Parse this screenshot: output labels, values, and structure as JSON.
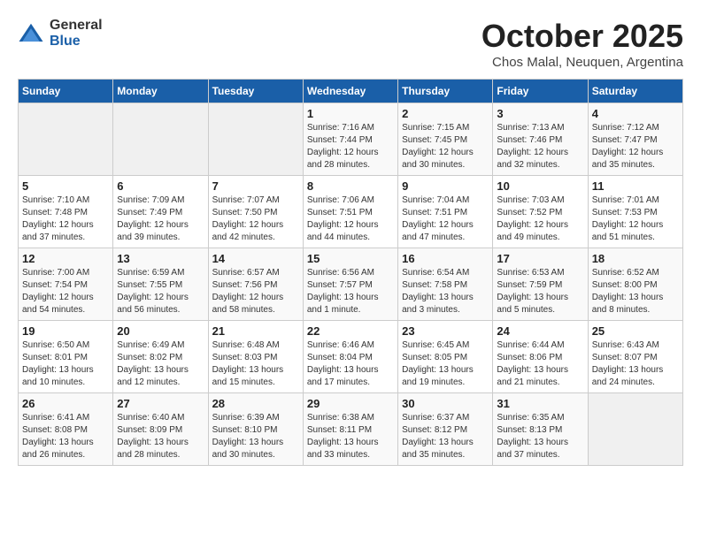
{
  "header": {
    "logo_general": "General",
    "logo_blue": "Blue",
    "month_year": "October 2025",
    "location": "Chos Malal, Neuquen, Argentina"
  },
  "weekdays": [
    "Sunday",
    "Monday",
    "Tuesday",
    "Wednesday",
    "Thursday",
    "Friday",
    "Saturday"
  ],
  "weeks": [
    [
      {
        "day": "",
        "info": ""
      },
      {
        "day": "",
        "info": ""
      },
      {
        "day": "",
        "info": ""
      },
      {
        "day": "1",
        "info": "Sunrise: 7:16 AM\nSunset: 7:44 PM\nDaylight: 12 hours\nand 28 minutes."
      },
      {
        "day": "2",
        "info": "Sunrise: 7:15 AM\nSunset: 7:45 PM\nDaylight: 12 hours\nand 30 minutes."
      },
      {
        "day": "3",
        "info": "Sunrise: 7:13 AM\nSunset: 7:46 PM\nDaylight: 12 hours\nand 32 minutes."
      },
      {
        "day": "4",
        "info": "Sunrise: 7:12 AM\nSunset: 7:47 PM\nDaylight: 12 hours\nand 35 minutes."
      }
    ],
    [
      {
        "day": "5",
        "info": "Sunrise: 7:10 AM\nSunset: 7:48 PM\nDaylight: 12 hours\nand 37 minutes."
      },
      {
        "day": "6",
        "info": "Sunrise: 7:09 AM\nSunset: 7:49 PM\nDaylight: 12 hours\nand 39 minutes."
      },
      {
        "day": "7",
        "info": "Sunrise: 7:07 AM\nSunset: 7:50 PM\nDaylight: 12 hours\nand 42 minutes."
      },
      {
        "day": "8",
        "info": "Sunrise: 7:06 AM\nSunset: 7:51 PM\nDaylight: 12 hours\nand 44 minutes."
      },
      {
        "day": "9",
        "info": "Sunrise: 7:04 AM\nSunset: 7:51 PM\nDaylight: 12 hours\nand 47 minutes."
      },
      {
        "day": "10",
        "info": "Sunrise: 7:03 AM\nSunset: 7:52 PM\nDaylight: 12 hours\nand 49 minutes."
      },
      {
        "day": "11",
        "info": "Sunrise: 7:01 AM\nSunset: 7:53 PM\nDaylight: 12 hours\nand 51 minutes."
      }
    ],
    [
      {
        "day": "12",
        "info": "Sunrise: 7:00 AM\nSunset: 7:54 PM\nDaylight: 12 hours\nand 54 minutes."
      },
      {
        "day": "13",
        "info": "Sunrise: 6:59 AM\nSunset: 7:55 PM\nDaylight: 12 hours\nand 56 minutes."
      },
      {
        "day": "14",
        "info": "Sunrise: 6:57 AM\nSunset: 7:56 PM\nDaylight: 12 hours\nand 58 minutes."
      },
      {
        "day": "15",
        "info": "Sunrise: 6:56 AM\nSunset: 7:57 PM\nDaylight: 13 hours\nand 1 minute."
      },
      {
        "day": "16",
        "info": "Sunrise: 6:54 AM\nSunset: 7:58 PM\nDaylight: 13 hours\nand 3 minutes."
      },
      {
        "day": "17",
        "info": "Sunrise: 6:53 AM\nSunset: 7:59 PM\nDaylight: 13 hours\nand 5 minutes."
      },
      {
        "day": "18",
        "info": "Sunrise: 6:52 AM\nSunset: 8:00 PM\nDaylight: 13 hours\nand 8 minutes."
      }
    ],
    [
      {
        "day": "19",
        "info": "Sunrise: 6:50 AM\nSunset: 8:01 PM\nDaylight: 13 hours\nand 10 minutes."
      },
      {
        "day": "20",
        "info": "Sunrise: 6:49 AM\nSunset: 8:02 PM\nDaylight: 13 hours\nand 12 minutes."
      },
      {
        "day": "21",
        "info": "Sunrise: 6:48 AM\nSunset: 8:03 PM\nDaylight: 13 hours\nand 15 minutes."
      },
      {
        "day": "22",
        "info": "Sunrise: 6:46 AM\nSunset: 8:04 PM\nDaylight: 13 hours\nand 17 minutes."
      },
      {
        "day": "23",
        "info": "Sunrise: 6:45 AM\nSunset: 8:05 PM\nDaylight: 13 hours\nand 19 minutes."
      },
      {
        "day": "24",
        "info": "Sunrise: 6:44 AM\nSunset: 8:06 PM\nDaylight: 13 hours\nand 21 minutes."
      },
      {
        "day": "25",
        "info": "Sunrise: 6:43 AM\nSunset: 8:07 PM\nDaylight: 13 hours\nand 24 minutes."
      }
    ],
    [
      {
        "day": "26",
        "info": "Sunrise: 6:41 AM\nSunset: 8:08 PM\nDaylight: 13 hours\nand 26 minutes."
      },
      {
        "day": "27",
        "info": "Sunrise: 6:40 AM\nSunset: 8:09 PM\nDaylight: 13 hours\nand 28 minutes."
      },
      {
        "day": "28",
        "info": "Sunrise: 6:39 AM\nSunset: 8:10 PM\nDaylight: 13 hours\nand 30 minutes."
      },
      {
        "day": "29",
        "info": "Sunrise: 6:38 AM\nSunset: 8:11 PM\nDaylight: 13 hours\nand 33 minutes."
      },
      {
        "day": "30",
        "info": "Sunrise: 6:37 AM\nSunset: 8:12 PM\nDaylight: 13 hours\nand 35 minutes."
      },
      {
        "day": "31",
        "info": "Sunrise: 6:35 AM\nSunset: 8:13 PM\nDaylight: 13 hours\nand 37 minutes."
      },
      {
        "day": "",
        "info": ""
      }
    ]
  ]
}
